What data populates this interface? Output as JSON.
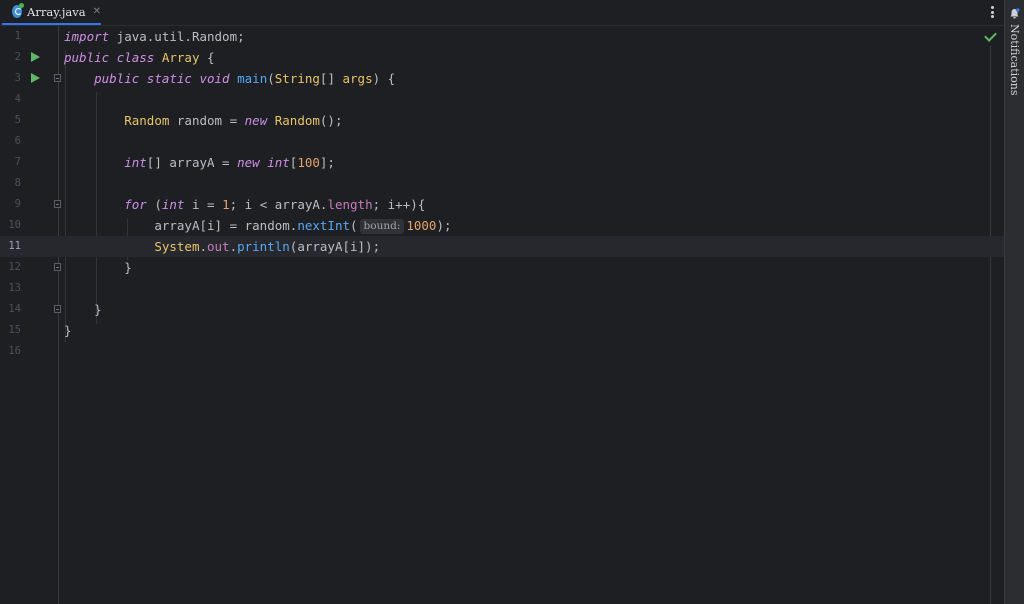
{
  "tab": {
    "title": "Array.java",
    "close": "✕"
  },
  "right_strip": {
    "notifications_label": "Notifications"
  },
  "editor": {
    "current_line": 11,
    "line_numbers": [
      "1",
      "2",
      "3",
      "4",
      "5",
      "6",
      "7",
      "8",
      "9",
      "10",
      "11",
      "12",
      "13",
      "14",
      "15",
      "16"
    ],
    "code": {
      "l1": {
        "kw": "import",
        "rest": " java.util.Random;"
      },
      "l2": {
        "kw1": "public",
        "kw2": "class",
        "cls": "Array",
        "rest": " {"
      },
      "l3": {
        "indent": "    ",
        "kw1": "public",
        "kw2": "static",
        "kw3": "void",
        "fn": "main",
        "p1": "(",
        "cls": "String",
        "p2": "[] ",
        "arg": "args",
        "p3": ") {"
      },
      "l5": {
        "indent": "        ",
        "cls1": "Random",
        "mid": " random = ",
        "kw": "new",
        "sp": " ",
        "cls2": "Random",
        "rest": "();"
      },
      "l7": {
        "indent": "        ",
        "kw1": "int",
        "mid": "[] arrayA = ",
        "kw2": "new",
        "sp": " ",
        "kw3": "int",
        "p1": "[",
        "num": "100",
        "rest": "];"
      },
      "l9": {
        "indent": "        ",
        "kw1": "for",
        "p1": " (",
        "kw2": "int",
        "mid": " i = ",
        "num": "1",
        "mid2": "; i < arrayA.",
        "fld": "length",
        "rest": "; i++){"
      },
      "l10": {
        "indent": "            ",
        "pre": "arrayA[i] = random.",
        "fn": "nextInt",
        "p1": "(",
        "hint": "bound:",
        "num": "1000",
        "rest": ");"
      },
      "l11": {
        "indent": "            ",
        "cls": "System",
        "dot1": ".",
        "fld": "out",
        "dot2": ".",
        "fn": "println",
        "rest": "(arrayA[i]);"
      },
      "l12": {
        "indent": "        ",
        "rest": "}"
      },
      "l14": {
        "indent": "    ",
        "rest": "}"
      },
      "l15": {
        "rest": "}"
      }
    }
  },
  "colors": {
    "background": "#1e1f22",
    "keyword": "#cf8ee8",
    "class": "#e8c46b",
    "function": "#56a8f5",
    "number": "#e6a36a",
    "field": "#c77dbb",
    "accent": "#3574f0",
    "run": "#5fb865"
  },
  "icons": [
    "java-class-icon",
    "close-icon",
    "more-options-icon",
    "notifications-bell-icon",
    "run-icon",
    "fold-icon",
    "check-icon"
  ]
}
